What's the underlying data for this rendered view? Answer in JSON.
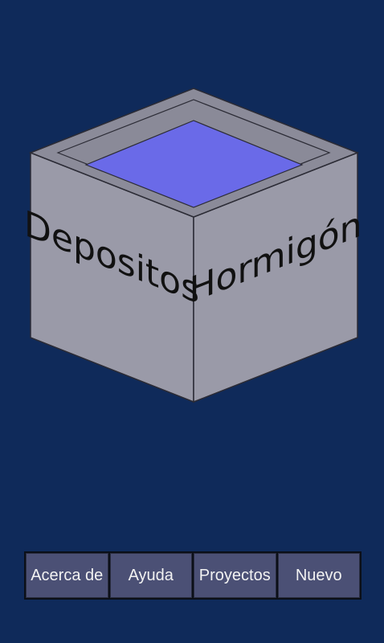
{
  "app": {
    "logo": {
      "left_text": "Depositos",
      "right_text": "Hormigón",
      "colors": {
        "box_face": "#9a9aa8",
        "rim": "#8b8b99",
        "water": "#6a6ae8",
        "outline": "#2b2b35",
        "background": "#0f2a5a"
      }
    },
    "menu": {
      "buttons": [
        {
          "label": "Acerca de"
        },
        {
          "label": "Ayuda"
        },
        {
          "label": "Proyectos"
        },
        {
          "label": "Nuevo"
        }
      ]
    }
  }
}
